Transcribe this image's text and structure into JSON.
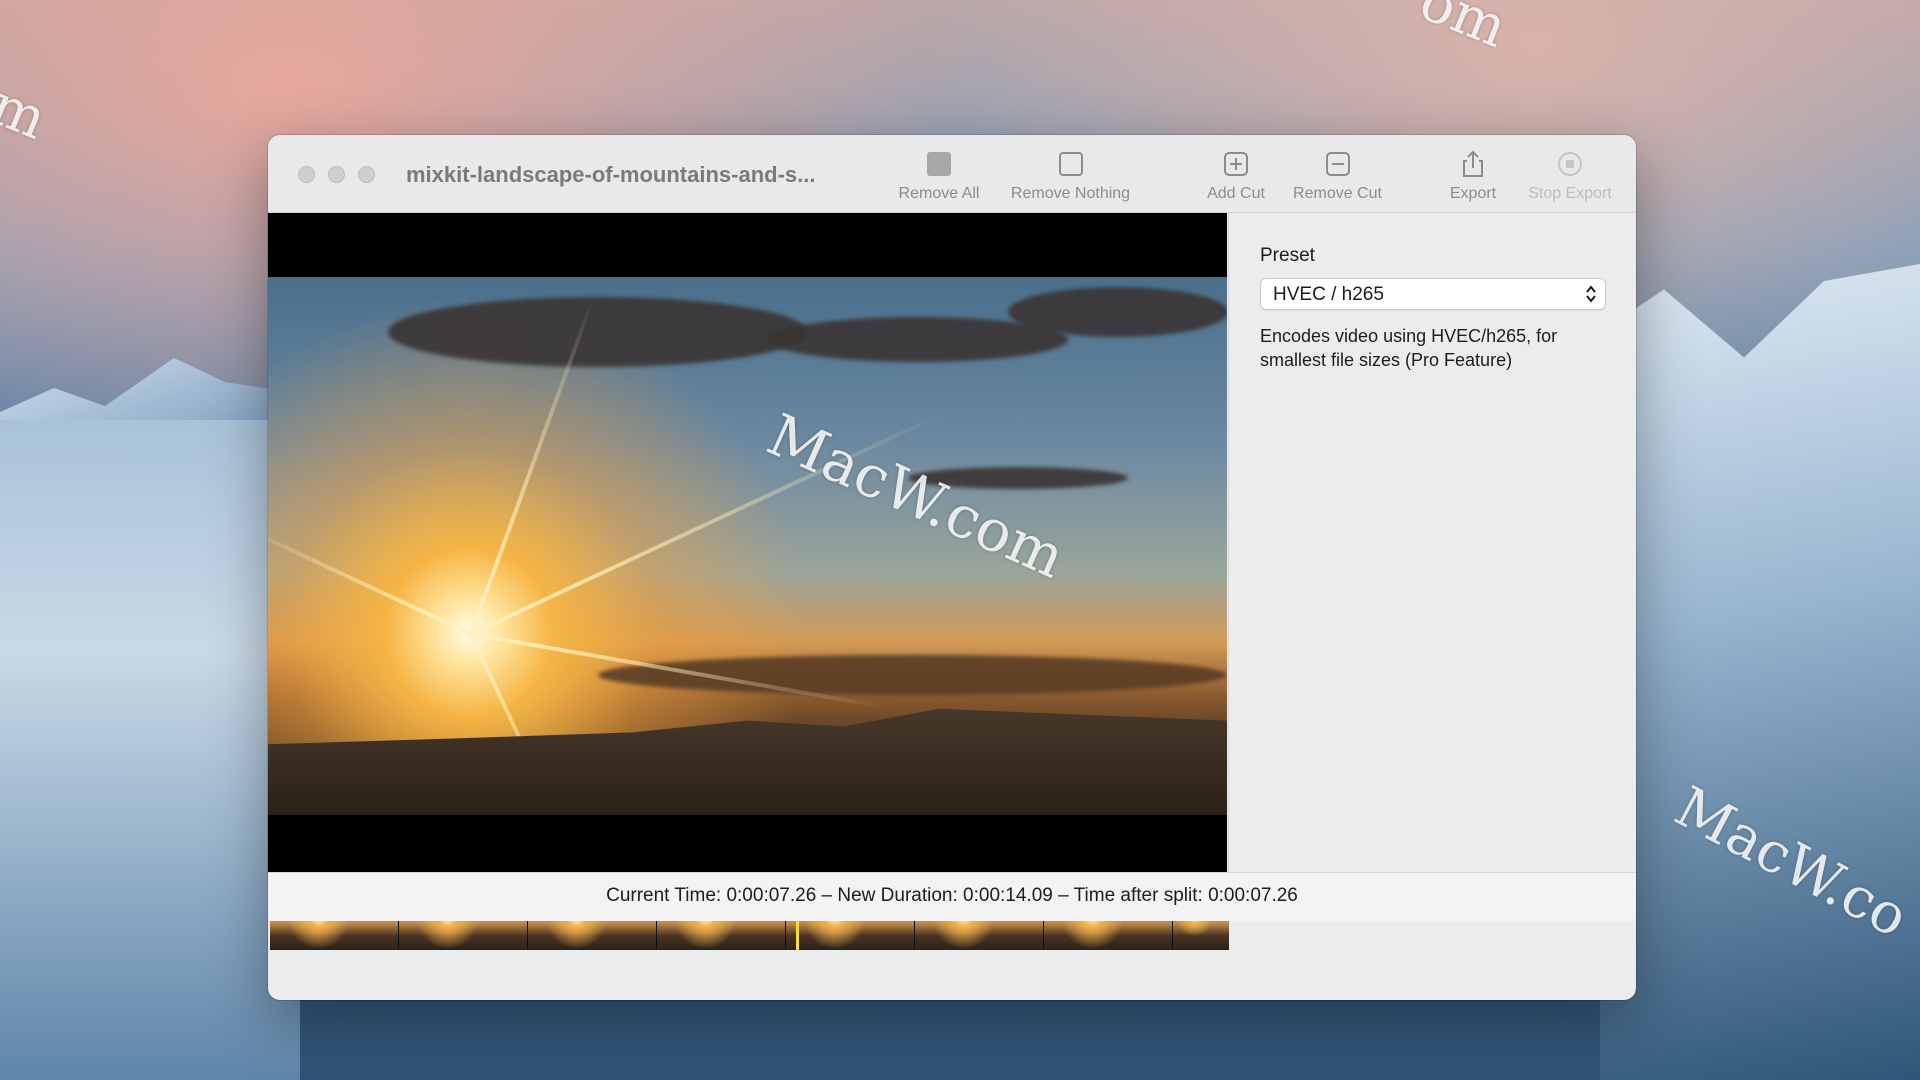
{
  "desktop": {
    "watermarks": [
      "MacW.com",
      "MacW.co",
      "m",
      "om"
    ]
  },
  "window": {
    "title": "mixkit-landscape-of-mountains-and-s...",
    "toolbar": {
      "remove_all": "Remove All",
      "remove_nothing": "Remove Nothing",
      "add_cut": "Add Cut",
      "remove_cut": "Remove Cut",
      "export": "Export",
      "stop_export": "Stop Export"
    },
    "video_watermark": "MacW.com",
    "playhead_fraction": 0.55
  },
  "side_panel": {
    "preset_label": "Preset",
    "preset_value": "HVEC / h265",
    "description": "Encodes video using HVEC/h265, for smallest file sizes (Pro Feature)"
  },
  "status": {
    "text": "Current Time: 0:00:07.26 – New Duration: 0:00:14.09 – Time after split: 0:00:07.26"
  },
  "colors": {
    "playhead": "#f6e02a",
    "window_bg": "#ececee"
  }
}
